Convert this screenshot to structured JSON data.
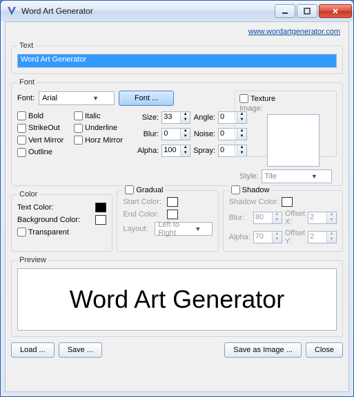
{
  "window": {
    "title": "Word Art Generator"
  },
  "link": {
    "url": "www.wordartgenerator.com"
  },
  "sections": {
    "text": {
      "legend": "Text",
      "value": "Word Art Generator"
    },
    "font": {
      "legend": "Font",
      "font_label": "Font:",
      "font_value": "Arial",
      "font_button": "Font ...",
      "checks": {
        "bold": "Bold",
        "italic": "Italic",
        "strikeout": "StrikeOut",
        "underline": "Underline",
        "vert_mirror": "Vert Mirror",
        "horz_mirror": "Horz Mirror",
        "outline": "Outline"
      },
      "size_label": "Size:",
      "size_value": "33",
      "angle_label": "Angle:",
      "angle_value": "0",
      "blur_label": "Blur:",
      "blur_value": "0",
      "noise_label": "Noise:",
      "noise_value": "0",
      "alpha_label": "Alpha:",
      "alpha_value": "100",
      "spray_label": "Spray:",
      "spray_value": "0"
    },
    "texture": {
      "legend": "Texture",
      "image_label": "Image:",
      "style_label": "Style:",
      "style_value": "Tile"
    },
    "color": {
      "legend": "Color",
      "text_color_label": "Text Color:",
      "bg_color_label": "Background Color:",
      "transparent_label": "Transparent"
    },
    "gradual": {
      "legend": "Gradual",
      "start_label": "Start Color:",
      "end_label": "End Color:",
      "layout_label": "Layout:",
      "layout_value": "Left to Right"
    },
    "shadow": {
      "legend": "Shadow",
      "color_label": "Shadow Color:",
      "blur_label": "Blur:",
      "blur_value": "80",
      "offsetx_label": "Offset X:",
      "offsetx_value": "2",
      "alpha_label": "Alpha:",
      "alpha_value": "70",
      "offsety_label": "Offset Y:",
      "offsety_value": "2"
    },
    "preview": {
      "legend": "Preview",
      "text": "Word Art Generator"
    }
  },
  "footer": {
    "load": "Load ...",
    "save": "Save ...",
    "save_image": "Save as Image ...",
    "close": "Close"
  }
}
